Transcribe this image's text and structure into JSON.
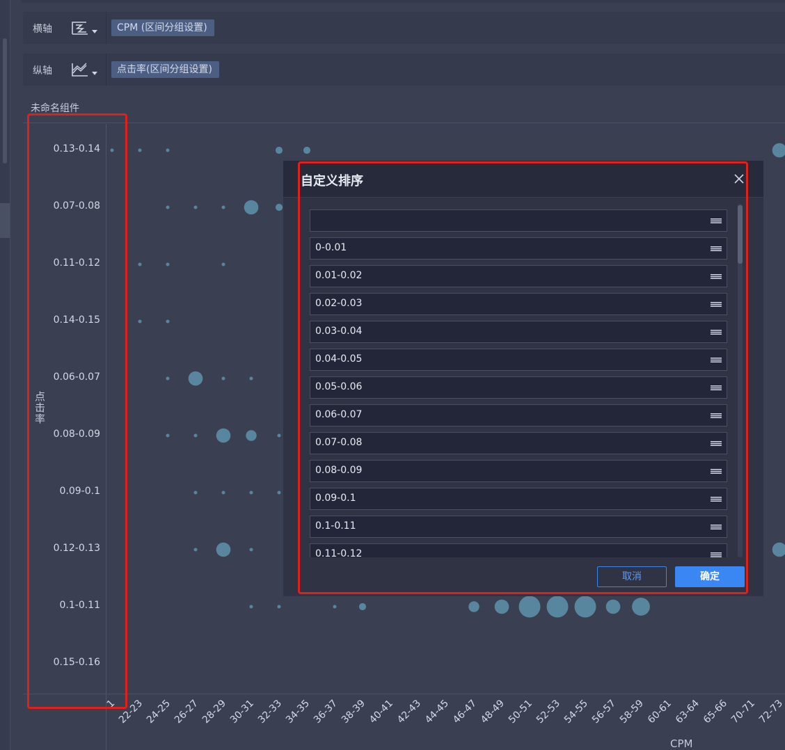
{
  "axis_config": {
    "x": {
      "label": "横轴",
      "icon": "bins-icon",
      "field_chip": "CPM (区间分组设置)"
    },
    "y": {
      "label": "纵轴",
      "icon": "area-chart-icon",
      "field_chip": "点击率(区间分组设置)"
    }
  },
  "widget": {
    "title": "未命名组件"
  },
  "chart_data": {
    "type": "scatter",
    "xlabel": "CPM",
    "ylabel": "点击率",
    "x_tick_labels": [
      "1",
      "22-23",
      "24-25",
      "26-27",
      "28-29",
      "30-31",
      "32-33",
      "34-35",
      "36-37",
      "38-39",
      "40-41",
      "42-43",
      "44-45",
      "46-47",
      "48-49",
      "50-51",
      "52-53",
      "54-55",
      "56-57",
      "58-59",
      "60-61",
      "63-64",
      "65-66",
      "70-71",
      "72-73"
    ],
    "y_tick_labels": [
      "0.13-0.14",
      "0.07-0.08",
      "0.11-0.12",
      "0.14-0.15",
      "0.06-0.07",
      "0.08-0.09",
      "0.09-0.1",
      "0.12-0.13",
      "0.1-0.11",
      "0.15-0.16"
    ],
    "points": [
      {
        "x": "1",
        "y": "0.13-0.14",
        "size": 1
      },
      {
        "x": "22-23",
        "y": "0.13-0.14",
        "size": 1
      },
      {
        "x": "24-25",
        "y": "0.13-0.14",
        "size": 1
      },
      {
        "x": "32-33",
        "y": "0.13-0.14",
        "size": 2
      },
      {
        "x": "34-35",
        "y": "0.13-0.14",
        "size": 2
      },
      {
        "x": "24-25",
        "y": "0.07-0.08",
        "size": 1
      },
      {
        "x": "26-27",
        "y": "0.07-0.08",
        "size": 1
      },
      {
        "x": "28-29",
        "y": "0.07-0.08",
        "size": 1
      },
      {
        "x": "30-31",
        "y": "0.07-0.08",
        "size": 4
      },
      {
        "x": "32-33",
        "y": "0.07-0.08",
        "size": 2
      },
      {
        "x": "22-23",
        "y": "0.11-0.12",
        "size": 1
      },
      {
        "x": "24-25",
        "y": "0.11-0.12",
        "size": 1
      },
      {
        "x": "28-29",
        "y": "0.11-0.12",
        "size": 1
      },
      {
        "x": "22-23",
        "y": "0.14-0.15",
        "size": 1
      },
      {
        "x": "24-25",
        "y": "0.14-0.15",
        "size": 1
      },
      {
        "x": "24-25",
        "y": "0.06-0.07",
        "size": 1
      },
      {
        "x": "26-27",
        "y": "0.06-0.07",
        "size": 4
      },
      {
        "x": "28-29",
        "y": "0.06-0.07",
        "size": 1
      },
      {
        "x": "30-31",
        "y": "0.06-0.07",
        "size": 1
      },
      {
        "x": "24-25",
        "y": "0.08-0.09",
        "size": 1
      },
      {
        "x": "26-27",
        "y": "0.08-0.09",
        "size": 1
      },
      {
        "x": "28-29",
        "y": "0.08-0.09",
        "size": 4
      },
      {
        "x": "30-31",
        "y": "0.08-0.09",
        "size": 3
      },
      {
        "x": "32-33",
        "y": "0.08-0.09",
        "size": 1
      },
      {
        "x": "26-27",
        "y": "0.09-0.1",
        "size": 1
      },
      {
        "x": "28-29",
        "y": "0.09-0.1",
        "size": 1
      },
      {
        "x": "30-31",
        "y": "0.09-0.1",
        "size": 1
      },
      {
        "x": "32-33",
        "y": "0.09-0.1",
        "size": 1
      },
      {
        "x": "26-27",
        "y": "0.12-0.13",
        "size": 1
      },
      {
        "x": "28-29",
        "y": "0.12-0.13",
        "size": 4
      },
      {
        "x": "30-31",
        "y": "0.12-0.13",
        "size": 1
      },
      {
        "x": "30-31",
        "y": "0.1-0.11",
        "size": 1
      },
      {
        "x": "32-33",
        "y": "0.1-0.11",
        "size": 1
      },
      {
        "x": "36-37",
        "y": "0.1-0.11",
        "size": 1
      },
      {
        "x": "38-39",
        "y": "0.1-0.11",
        "size": 2
      },
      {
        "x": "46-47",
        "y": "0.1-0.11",
        "size": 3
      },
      {
        "x": "48-49",
        "y": "0.1-0.11",
        "size": 4
      },
      {
        "x": "50-51",
        "y": "0.1-0.11",
        "size": 6
      },
      {
        "x": "52-53",
        "y": "0.1-0.11",
        "size": 6
      },
      {
        "x": "54-55",
        "y": "0.1-0.11",
        "size": 6
      },
      {
        "x": "56-57",
        "y": "0.1-0.11",
        "size": 4
      },
      {
        "x": "58-59",
        "y": "0.1-0.11",
        "size": 5
      },
      {
        "x": "72-73",
        "y": "0.13-0.14",
        "size": 4
      },
      {
        "x": "72-73",
        "y": "0.12-0.13",
        "size": 4
      }
    ],
    "point_color": "#58869f",
    "legend": "none"
  },
  "dialog": {
    "title": "自定义排序",
    "items": [
      "",
      "0-0.01",
      "0.01-0.02",
      "0.02-0.03",
      "0.03-0.04",
      "0.04-0.05",
      "0.05-0.06",
      "0.06-0.07",
      "0.07-0.08",
      "0.08-0.09",
      "0.09-0.1",
      "0.1-0.11",
      "0.11-0.12"
    ],
    "cancel_label": "取消",
    "ok_label": "确定"
  },
  "colors": {
    "annotation": "#e0201a",
    "primary": "#3a86f2",
    "background": "#3a3f52"
  }
}
